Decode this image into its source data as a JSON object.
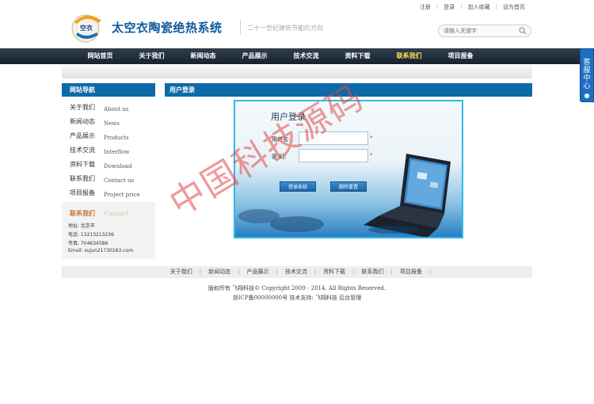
{
  "top_links": [
    "注册",
    "登录",
    "加入收藏",
    "设为首页"
  ],
  "header": {
    "site_title": "太空衣陶瓷绝热系统",
    "slogan": "二十一世纪建筑节能的方向"
  },
  "search": {
    "placeholder": "请输入关键字"
  },
  "nav": {
    "items": [
      "网站首页",
      "关于我们",
      "新闻动态",
      "产品展示",
      "技术交流",
      "资料下载",
      "联系我们",
      "项目报备"
    ],
    "active_index": 6
  },
  "side_tab": {
    "label": "客服中心"
  },
  "left_nav": {
    "heading": "网站导航",
    "items": [
      {
        "cn": "关于我们",
        "en": "About us"
      },
      {
        "cn": "新闻动态",
        "en": "News"
      },
      {
        "cn": "产品展示",
        "en": "Products"
      },
      {
        "cn": "技术交流",
        "en": "Interflow"
      },
      {
        "cn": "资料下载",
        "en": "Download"
      },
      {
        "cn": "联系我们",
        "en": "Contact us"
      },
      {
        "cn": "项目报备",
        "en": "Project price"
      }
    ]
  },
  "contact": {
    "heading": "联系我们",
    "heading_en": "Contact",
    "address": "地址:   北京市",
    "phone": "电话:   13213213236",
    "fax": "传真:   704634586",
    "email": "Email:  sujun21730163.com"
  },
  "main": {
    "heading": "用户登录",
    "login_title": "用户登录",
    "username_label": "用户名:",
    "password_label": "密   码:",
    "username_value": "",
    "password_value": "",
    "required_mark": "*",
    "login_button": "登录系统",
    "reset_button": "删除重置"
  },
  "footer": {
    "links": [
      "关于我们",
      "新闻动态",
      "产品展示",
      "技术交流",
      "资料下载",
      "联系我们",
      "项目报备"
    ],
    "copyright": "版权所有 飞翔科技© Copyright 2009 - 2014. All Rights Reserved.",
    "icp": "浙ICP备00000000号  技术支持: 飞翔科技  后台管理"
  },
  "watermark": "中国科技源码"
}
